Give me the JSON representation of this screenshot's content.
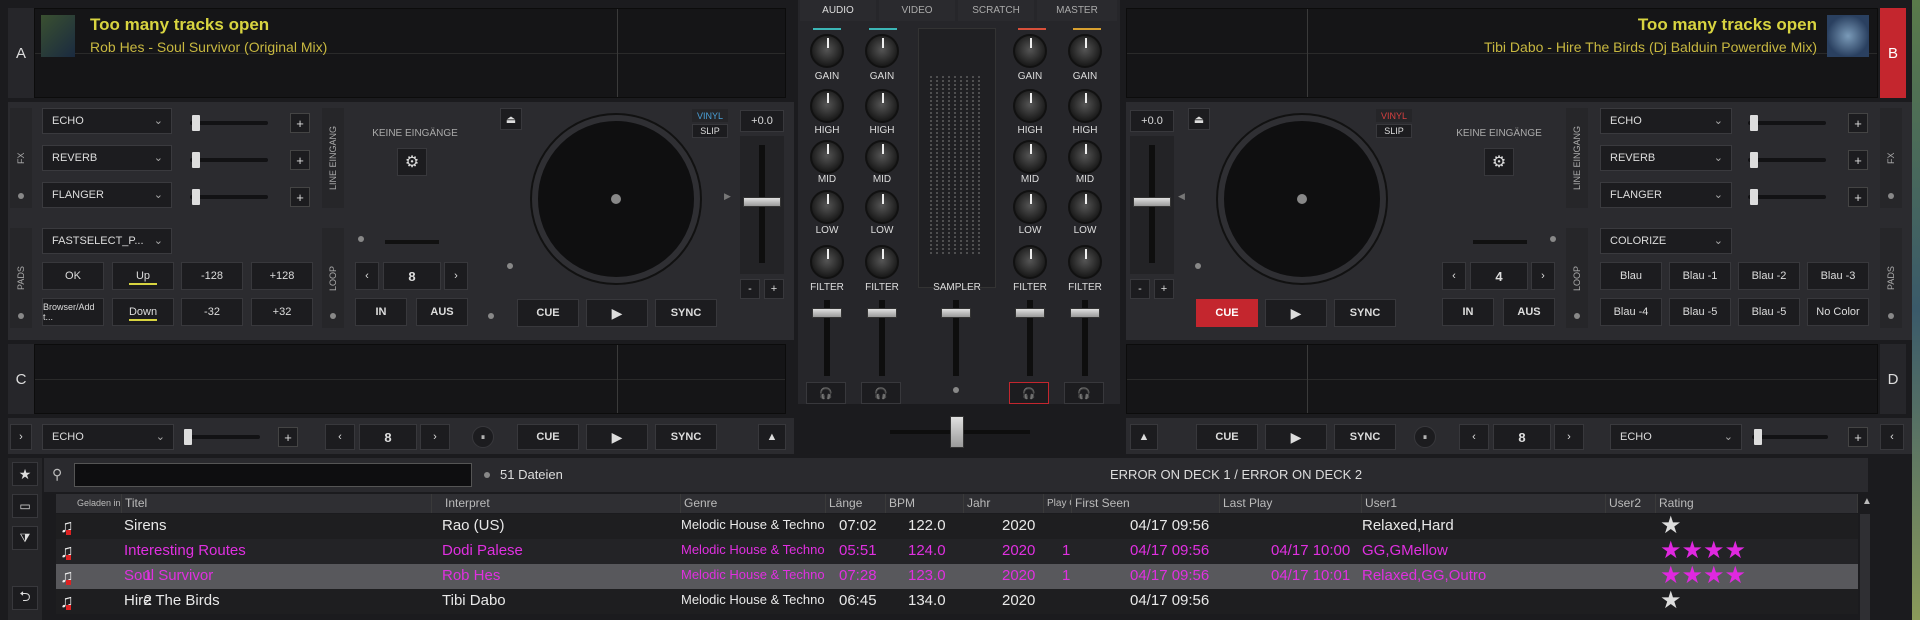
{
  "decks": {
    "a": {
      "letter": "A",
      "title": "Too many tracks open",
      "track": "Rob Hes - Soul Survivor (Original Mix)",
      "pitch": "+0.0",
      "vinyl": "VINYL",
      "slip": "SLIP",
      "loop": "8",
      "in": "IN",
      "out": "AUS",
      "cue": "CUE",
      "sync": "SYNC"
    },
    "b": {
      "letter": "B",
      "title": "Too many tracks open",
      "track": "Tibi Dabo - Hire The Birds (Dj Balduin Powerdive Mix)",
      "pitch": "+0.0",
      "vinyl": "VINYL",
      "slip": "SLIP",
      "loop": "4",
      "in": "IN",
      "out": "AUS",
      "cue": "CUE",
      "sync": "SYNC"
    },
    "c": {
      "letter": "C",
      "fx": "ECHO",
      "loop": "8",
      "cue": "CUE",
      "sync": "SYNC"
    },
    "d": {
      "letter": "D",
      "fx": "ECHO",
      "loop": "8",
      "cue": "CUE",
      "sync": "SYNC"
    }
  },
  "fx_left": [
    "ECHO",
    "REVERB",
    "FLANGER"
  ],
  "fx_right": [
    "ECHO",
    "REVERB",
    "FLANGER"
  ],
  "labels": {
    "fx": "FX",
    "pads": "PADS",
    "loop": "LOOP",
    "line": "LINE EINGANG",
    "keine": "KEINE EINGÄNGE",
    "plus": "+",
    "minus": "-"
  },
  "pads_left": {
    "select": "FASTSELECT_P...",
    "buttons": [
      "OK",
      "Up",
      "-128",
      "+128",
      "Browser/Add t...",
      "Down",
      "-32",
      "+32"
    ]
  },
  "pads_right": {
    "select": "COLORIZE",
    "buttons": [
      "Blau",
      "Blau -1",
      "Blau -2",
      "Blau -3",
      "Blau -4",
      "Blau -5",
      "Blau -5",
      "No Color"
    ]
  },
  "mixer": {
    "tabs": [
      "AUDIO",
      "VIDEO",
      "SCRATCH",
      "MASTER"
    ],
    "knob_labels": [
      "GAIN",
      "HIGH",
      "MID",
      "LOW",
      "FILTER"
    ],
    "sampler": "SAMPLER"
  },
  "browser": {
    "search_placeholder": "",
    "count": "51 Dateien",
    "error": "ERROR ON DECK 1 / ERROR ON DECK 2",
    "columns": [
      "Geladen in",
      "Titel",
      "Interpret",
      "Genre",
      "Länge",
      "BPM",
      "Jahr",
      "Play C",
      "First Seen",
      "Last Play",
      "User1",
      "User2",
      "Rating"
    ],
    "rows": [
      {
        "loaded": "",
        "title": "Sirens",
        "artist": "Rao (US)",
        "genre": "Melodic House & Techno",
        "length": "07:02",
        "bpm": "122.0",
        "year": "2020",
        "plays": "",
        "first": "04/17 09:56",
        "last": "",
        "user1": "Relaxed,Hard",
        "rating": 1,
        "color": "#e8e8e8",
        "bg": "#1e1e20"
      },
      {
        "loaded": "",
        "title": "Interesting Routes",
        "artist": "Dodi Palese",
        "genre": "Melodic House & Techno",
        "length": "05:51",
        "bpm": "124.0",
        "year": "2020",
        "plays": "1",
        "first": "04/17 09:56",
        "last": "04/17 10:00",
        "user1": "GG,GMellow",
        "rating": 4,
        "color": "#e030e0",
        "bg": "#232326"
      },
      {
        "loaded": "1",
        "title": "Soul Survivor",
        "artist": "Rob Hes",
        "genre": "Melodic House & Techno",
        "length": "07:28",
        "bpm": "123.0",
        "year": "2020",
        "plays": "1",
        "first": "04/17 09:56",
        "last": "04/17 10:01",
        "user1": "Relaxed,GG,Outro",
        "rating": 4,
        "color": "#e030e0",
        "bg": "#58585c"
      },
      {
        "loaded": "2",
        "title": "Hire The Birds",
        "artist": "Tibi Dabo",
        "genre": "Melodic House & Techno",
        "length": "06:45",
        "bpm": "134.0",
        "year": "2020",
        "plays": "",
        "first": "04/17 09:56",
        "last": "",
        "user1": "",
        "rating": 1,
        "color": "#e8e8e8",
        "bg": "#1e1e20"
      }
    ]
  },
  "colors": {
    "accent": "#d8d440",
    "pink": "#e030e0",
    "red": "#c4262e"
  }
}
